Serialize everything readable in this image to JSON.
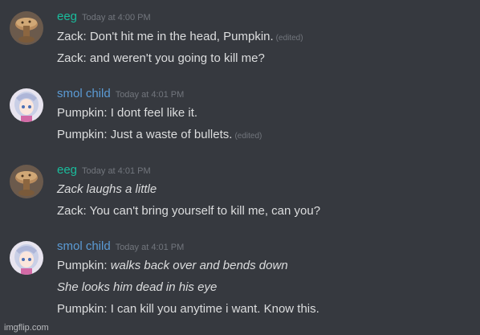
{
  "colors": {
    "background": "#36393f",
    "eeg_name": "#1abc9c",
    "smol_name": "#5b9bd5",
    "text": "#dcddde",
    "muted": "#72767d"
  },
  "groups": [
    {
      "username": "eeg",
      "timestamp": "Today at 4:00 PM",
      "avatar_icon": "cookie-avatar-icon",
      "lines": [
        {
          "text": "Zack: Don't hit me in the head, Pumpkin.",
          "edited": "(edited)"
        },
        {
          "text": "Zack: and weren't you going to kill me?"
        }
      ]
    },
    {
      "username": "smol child",
      "timestamp": "Today at 4:01 PM",
      "avatar_icon": "anime-girl-avatar-icon",
      "lines": [
        {
          "text": "Pumpkin: I dont feel like it."
        },
        {
          "text": "Pumpkin: Just a waste of bullets.",
          "edited": "(edited)"
        }
      ]
    },
    {
      "username": "eeg",
      "timestamp": "Today at 4:01 PM",
      "avatar_icon": "cookie-avatar-icon",
      "lines": [
        {
          "text": "Zack laughs a little"
        },
        {
          "text": "Zack: You can't bring yourself to kill me, can you?"
        }
      ]
    },
    {
      "username": "smol child",
      "timestamp": "Today at 4:01 PM",
      "avatar_icon": "anime-girl-avatar-icon",
      "lines": [
        {
          "prefix": "Pumpkin: ",
          "text": "walks back over and bends down"
        },
        {
          "text": "She looks him dead in his eye"
        },
        {
          "text": "Pumpkin: I can kill you anytime i want. Know this."
        }
      ]
    }
  ],
  "watermark": "imgflip.com"
}
